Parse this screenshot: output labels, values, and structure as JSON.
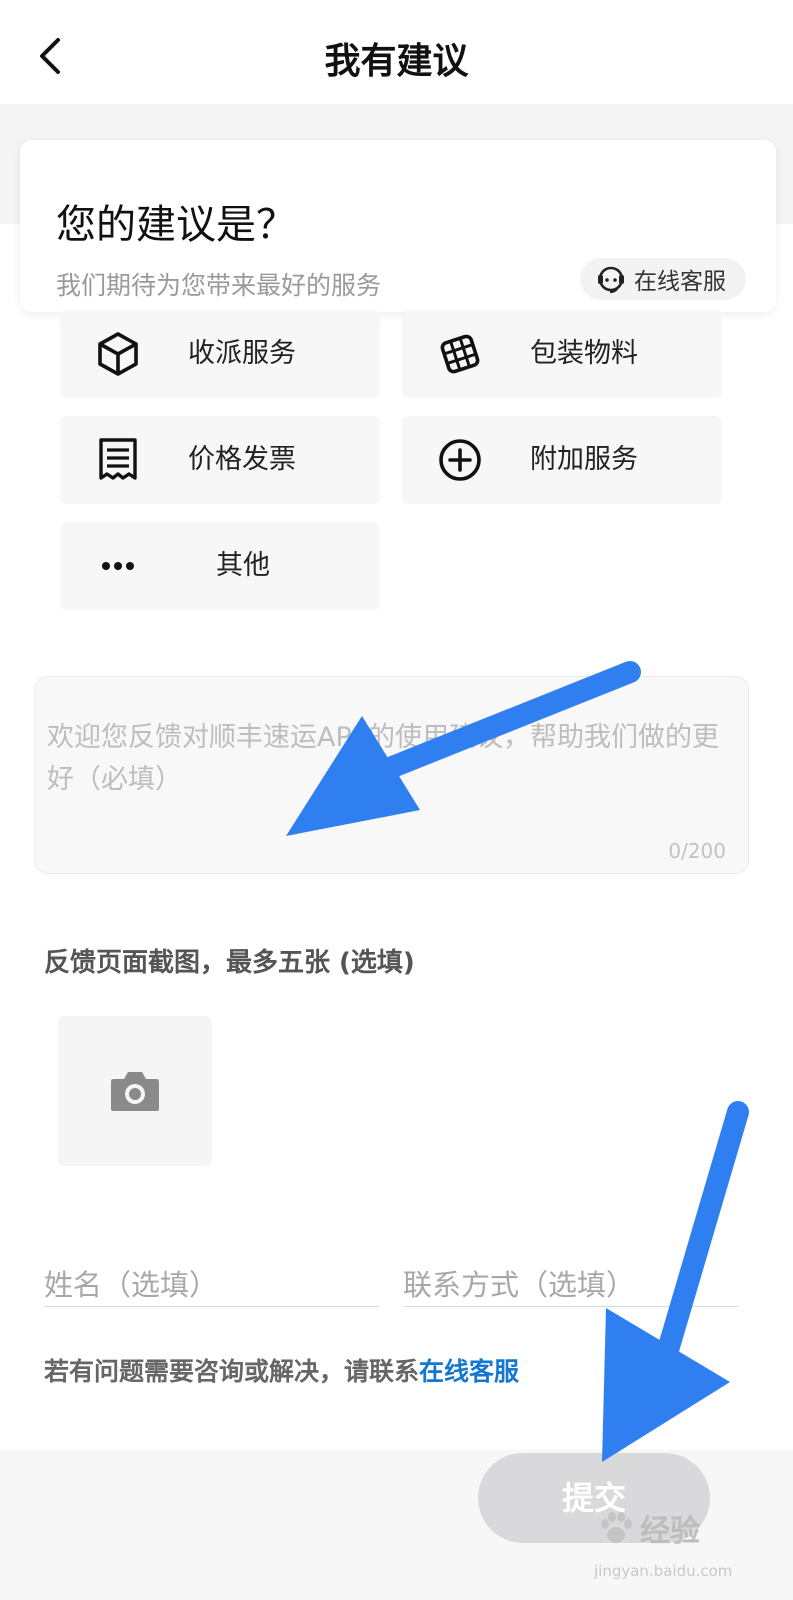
{
  "header": {
    "title": "我有建议"
  },
  "intro": {
    "title": "您的建议是？",
    "subtitle": "我们期待为您带来最好的服务",
    "cs_label": "在线客服"
  },
  "categories": [
    {
      "label": "收派服务",
      "icon": "package-box-icon"
    },
    {
      "label": "包装物料",
      "icon": "grid-box-icon"
    },
    {
      "label": "价格发票",
      "icon": "receipt-icon"
    },
    {
      "label": "附加服务",
      "icon": "plus-circle-icon"
    },
    {
      "label": "其他",
      "icon": "more-dots-icon"
    }
  ],
  "feedback": {
    "placeholder": "欢迎您反馈对顺丰速运APP的使用建议，帮助我们做的更好（必填）",
    "counter": "0/200"
  },
  "screenshots": {
    "title": "反馈页面截图，最多五张 (选填)"
  },
  "fields": {
    "name_placeholder": "姓名（选填）",
    "contact_placeholder": "联系方式（选填）"
  },
  "help": {
    "text": "若有问题需要咨询或解决，请联系",
    "link": "在线客服"
  },
  "submit": {
    "label": "提交"
  },
  "watermark": {
    "brand": "经验",
    "url": "jingyan.baidu.com"
  },
  "colors": {
    "link": "#1677d2",
    "arrow": "#2f7ff0",
    "submit_disabled": "#d9d9db"
  }
}
